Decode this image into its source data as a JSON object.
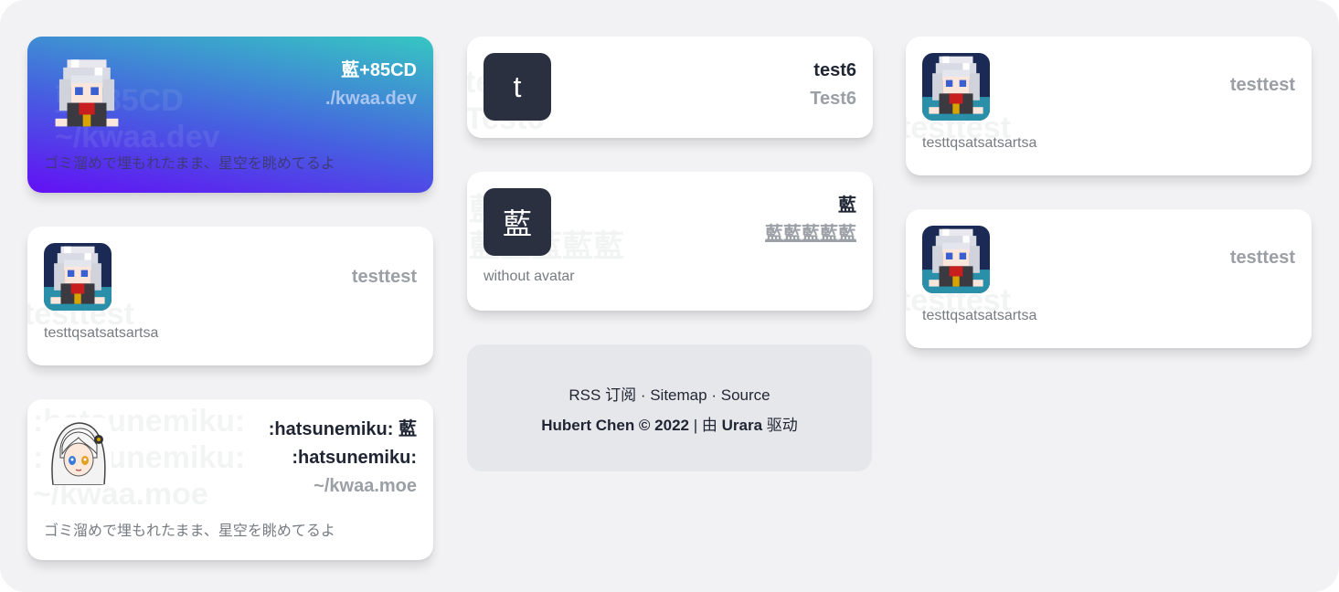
{
  "cards": [
    {
      "id": "c1",
      "name": "藍+85CD",
      "url": "./kwaa.dev",
      "desc": "ゴミ溜めで埋もれたまま、星空を眺めてるよ",
      "ghost": "藍+85CD\n~/kwaa.dev"
    },
    {
      "id": "c2",
      "name": "testtest",
      "desc": "testtqsatsatsartsa",
      "ghost": "testtest"
    },
    {
      "id": "c3",
      "name": ":hatsunemiku: 藍",
      "name2": ":hatsunemiku:",
      "url": "~/kwaa.moe",
      "desc": "ゴミ溜めで埋もれたまま、星空を眺めてるよ",
      "ghost": ":hatsunemiku:\n:hatsunemiku:\n~/kwaa.moe"
    },
    {
      "id": "c4",
      "letter": "t",
      "name": "test6",
      "url": "Test6",
      "ghost": "test6\nTest6"
    },
    {
      "id": "c5",
      "letter": "藍",
      "name": "藍",
      "url": "藍藍藍藍藍",
      "desc": "without avatar",
      "ghost": "藍\n藍藍藍藍藍"
    },
    {
      "id": "c6",
      "name": "testtest",
      "desc": "testtqsatsatsartsa",
      "ghost": "testtest"
    },
    {
      "id": "c7",
      "name": "testtest",
      "desc": "testtqsatsatsartsa",
      "ghost": "testtest"
    }
  ],
  "footer": {
    "rss": "RSS 订阅",
    "sep1": "·",
    "sitemap": "Sitemap",
    "sep2": "·",
    "source": "Source",
    "copyright": "Hubert Chen © 2022",
    "sep3": "|",
    "powered_prefix": "由",
    "urara": "Urara",
    "powered_suffix": "驱动"
  },
  "colors": {
    "background": "#f2f2f4",
    "card": "#ffffff",
    "name": "#1f2533",
    "url": "#9aa0a6",
    "desc": "#777c82",
    "letter_avatar": "#2b3040",
    "footer_bg": "#e6e7ea"
  },
  "icons": [
    "pixel-anime-girl-avatar",
    "anime-girl-avatar"
  ]
}
